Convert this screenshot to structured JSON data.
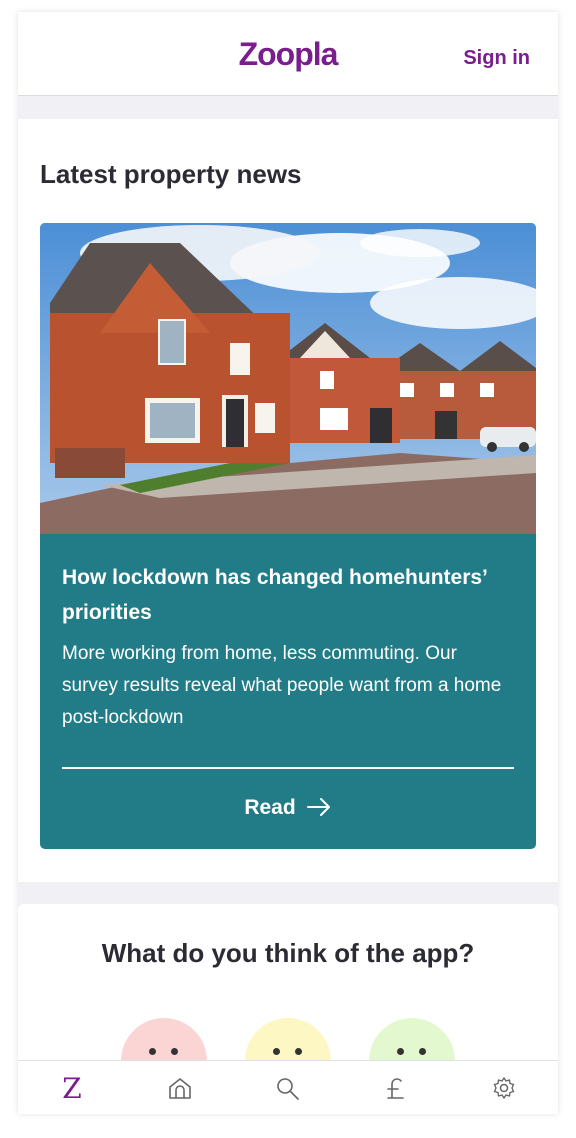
{
  "header": {
    "logo_text": "Zoopla",
    "sign_in_label": "Sign in"
  },
  "news": {
    "section_title": "Latest property news",
    "article": {
      "title": "How lockdown has changed homehunters’ priorities",
      "description": "More working from home, less commuting. Our survey results reveal what people want from a home post-lockdown",
      "read_label": "Read"
    }
  },
  "feedback": {
    "title": "What do you think of the app?",
    "faces": [
      "unhappy",
      "neutral",
      "happy"
    ]
  },
  "tabbar": {
    "items": [
      {
        "icon": "zoopla-z-icon",
        "label": "Z",
        "active": true
      },
      {
        "icon": "home-icon"
      },
      {
        "icon": "search-icon"
      },
      {
        "icon": "pound-icon"
      },
      {
        "icon": "gear-icon"
      }
    ]
  },
  "colors": {
    "brand": "#7a1d8f",
    "article_bg": "#217c87",
    "page_bg": "#f0f0f5",
    "text_dark": "#2b2b33"
  }
}
